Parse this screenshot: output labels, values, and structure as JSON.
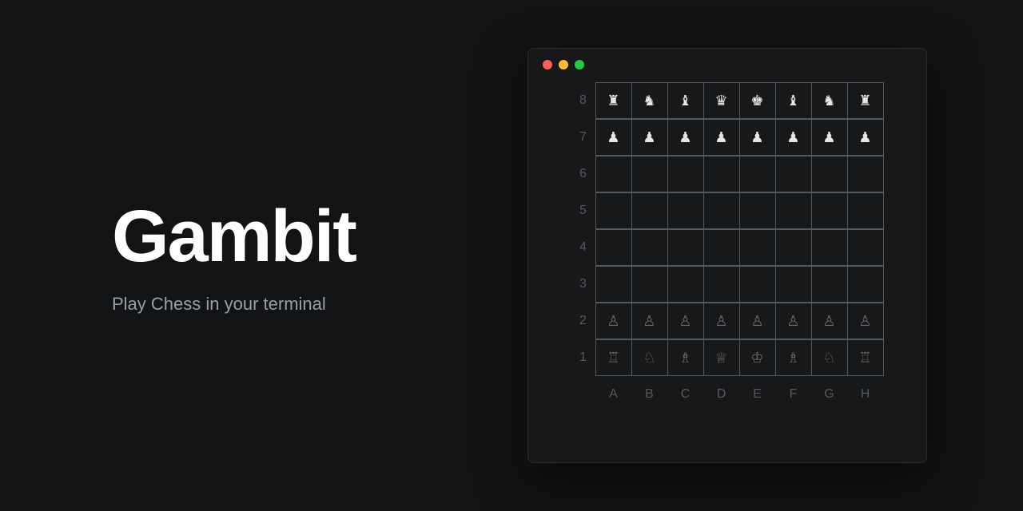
{
  "hero": {
    "title": "Gambit",
    "subtitle": "Play Chess in your terminal"
  },
  "terminal": {
    "traffic_colors": {
      "close": "#ff5f56",
      "minimize": "#ffbd2e",
      "zoom": "#27c93f"
    }
  },
  "board": {
    "ranks": [
      "8",
      "7",
      "6",
      "5",
      "4",
      "3",
      "2",
      "1"
    ],
    "files": [
      "A",
      "B",
      "C",
      "D",
      "E",
      "F",
      "G",
      "H"
    ],
    "rows": [
      {
        "style": "solid",
        "pieces": [
          "♜",
          "♞",
          "♝",
          "♛",
          "♚",
          "♝",
          "♞",
          "♜"
        ]
      },
      {
        "style": "solid",
        "pieces": [
          "♟",
          "♟",
          "♟",
          "♟",
          "♟",
          "♟",
          "♟",
          "♟"
        ]
      },
      {
        "style": "none",
        "pieces": [
          "",
          "",
          "",
          "",
          "",
          "",
          "",
          ""
        ]
      },
      {
        "style": "none",
        "pieces": [
          "",
          "",
          "",
          "",
          "",
          "",
          "",
          ""
        ]
      },
      {
        "style": "none",
        "pieces": [
          "",
          "",
          "",
          "",
          "",
          "",
          "",
          ""
        ]
      },
      {
        "style": "none",
        "pieces": [
          "",
          "",
          "",
          "",
          "",
          "",
          "",
          ""
        ]
      },
      {
        "style": "outline",
        "pieces": [
          "♙",
          "♙",
          "♙",
          "♙",
          "♙",
          "♙",
          "♙",
          "♙"
        ]
      },
      {
        "style": "outline",
        "pieces": [
          "♖",
          "♘",
          "♗",
          "♕",
          "♔",
          "♗",
          "♘",
          "♖"
        ]
      }
    ]
  }
}
